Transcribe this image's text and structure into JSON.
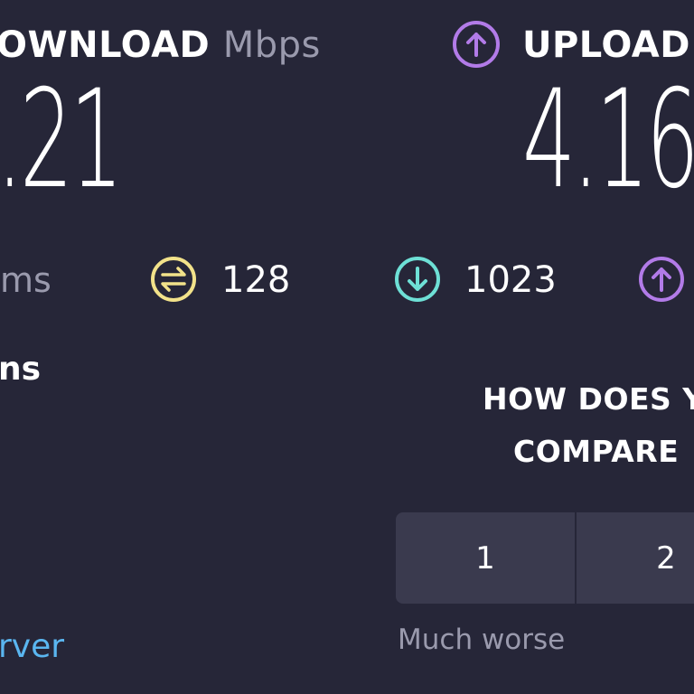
{
  "header": {
    "download_label": "OWNLOAD",
    "download_unit": "Mbps",
    "upload_label": "UPLOAD"
  },
  "results": {
    "download_value": ".21",
    "upload_value": "4.16"
  },
  "latency": {
    "unloaded_unit": "ms",
    "jitter_value": "128",
    "download_latency_value": "1023"
  },
  "misc": {
    "partial_ms": "ns",
    "server_link": "rver"
  },
  "compare": {
    "line1": "HOW DOES Y",
    "line2": "COMPARE",
    "options": [
      "1",
      "2"
    ],
    "low_label": "Much worse"
  },
  "colors": {
    "background": "#262638",
    "upload_accent": "#b27be8",
    "jitter_accent": "#f2e28a",
    "download_accent": "#6ee0d6",
    "link": "#5ab6f0",
    "muted": "#9a9aad"
  }
}
